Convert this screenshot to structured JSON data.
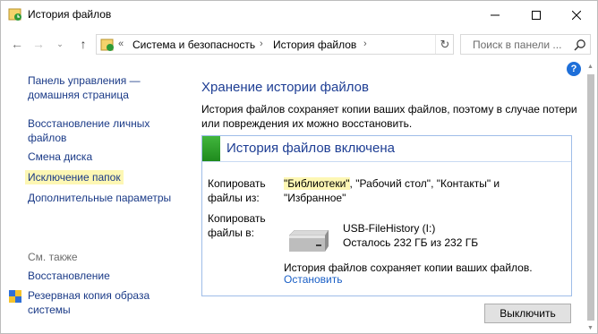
{
  "window": {
    "title": "История файлов",
    "icon": "file-history-icon",
    "controls": [
      "minimize",
      "maximize",
      "close"
    ]
  },
  "nav": {
    "recent_label": "⌄",
    "address_prefix": "«",
    "breadcrumbs": [
      "Система и безопасность",
      "История файлов"
    ],
    "search_placeholder": "Поиск в панели ..."
  },
  "sidebar": {
    "items": [
      {
        "label_line1": "Панель управления —",
        "label_line2": "домашняя страница"
      },
      {
        "label_line1": "Восстановление личных",
        "label_line2": "файлов"
      },
      {
        "label_line1": "Смена диска"
      },
      {
        "label_line1": "Исключение папок",
        "highlighted": true
      },
      {
        "label_line1": "Дополнительные параметры"
      }
    ],
    "see_also_title": "См. также",
    "see_also": [
      {
        "label_line1": "Восстановление"
      },
      {
        "label_line1": "Резервная копия образа",
        "label_line2": "системы",
        "icon": "shield-icon"
      }
    ]
  },
  "main": {
    "title": "Хранение истории файлов",
    "description_line1": "История файлов сохраняет копии ваших файлов, поэтому в случае потери",
    "description_line2": "или повреждения их можно восстановить.",
    "status": {
      "title": "История файлов включена",
      "copy_from_label_line1": "Копировать",
      "copy_from_label_line2": "файлы из:",
      "copy_from_hl": "\"Библиотеки\"",
      "copy_from_rest_line1": ", \"Рабочий стол\", \"Контакты\" и",
      "copy_from_rest_line2": "\"Избранное\"",
      "copy_to_label_line1": "Копировать",
      "copy_to_label_line2": "файлы в:",
      "drive_name": "USB-FileHistory (I:)",
      "drive_space": "Осталось 232 ГБ из 232 ГБ",
      "status_text": "История файлов сохраняет копии ваших файлов.",
      "stop_link": "Остановить"
    },
    "disable_button": "Выключить"
  },
  "colors": {
    "link": "#1a3a87",
    "heading": "#1e3e94",
    "highlight": "#fdf7b4",
    "status_green": "#2ea12a"
  }
}
